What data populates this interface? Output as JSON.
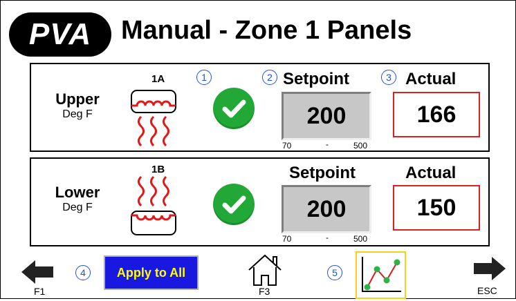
{
  "header": {
    "logo": "PVA",
    "title": "Manual - Zone 1 Panels"
  },
  "zones": [
    {
      "name": "Upper",
      "unit": "Deg F",
      "heater_label": "1A",
      "setpoint_label": "Setpoint",
      "actual_label": "Actual",
      "setpoint": "200",
      "actual": "166",
      "range_min": "70",
      "range_sep": "-",
      "range_max": "500",
      "status_icon": "check-icon"
    },
    {
      "name": "Lower",
      "unit": "Deg F",
      "heater_label": "1B",
      "setpoint_label": "Setpoint",
      "actual_label": "Actual",
      "setpoint": "200",
      "actual": "150",
      "range_min": "70",
      "range_sep": "-",
      "range_max": "500",
      "status_icon": "check-icon"
    }
  ],
  "badges": [
    "1",
    "2",
    "3",
    "4",
    "5"
  ],
  "footer": {
    "back_key": "F1",
    "apply_label": "Apply to All",
    "home_key": "F3",
    "next_key": "ESC"
  },
  "colors": {
    "accent_blue": "#1818e0",
    "apply_text": "#ffff00",
    "ok_green": "#21a836",
    "actual_border": "#e02020",
    "badge_blue": "#1f4fe0",
    "trend_border": "#f4d21a",
    "heater_red": "#e01818"
  }
}
